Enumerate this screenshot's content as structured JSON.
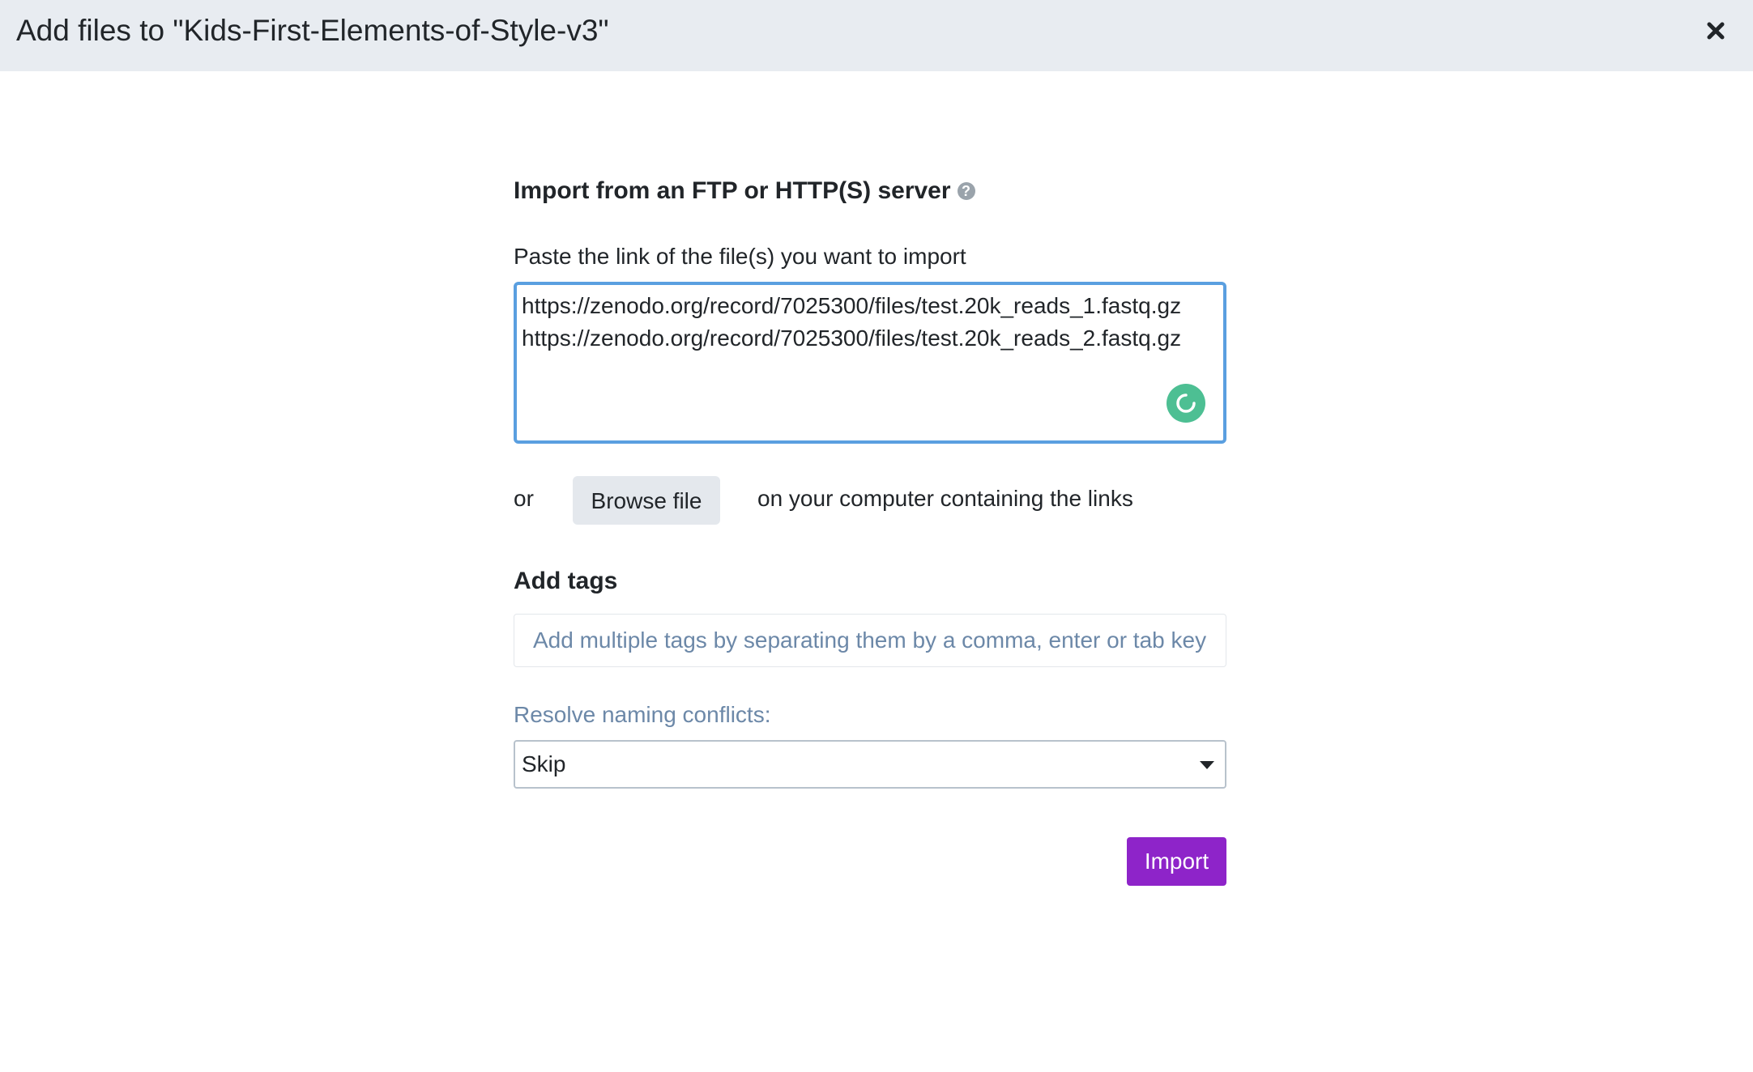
{
  "modal": {
    "title": "Add files to \"Kids-First-Elements-of-Style-v3\"",
    "close_icon": "close-icon"
  },
  "import_section": {
    "title": "Import from an FTP or HTTP(S) server",
    "help_icon": "question-circle-icon",
    "help_glyph": "?",
    "paste_label": "Paste the link of the file(s) you want to import",
    "urls_value": "https://zenodo.org/record/7025300/files/test.20k_reads_1.fastq.gz\nhttps://zenodo.org/record/7025300/files/test.20k_reads_2.fastq.gz",
    "spinner_icon": "loading-spinner-icon"
  },
  "browse": {
    "or_text": "or",
    "button_label": "Browse file",
    "after_text": "on your computer containing the links"
  },
  "tags": {
    "title": "Add tags",
    "placeholder": "Add multiple tags by separating them by a comma, enter or tab key"
  },
  "conflicts": {
    "label": "Resolve naming conflicts:",
    "selected": "Skip",
    "caret_icon": "caret-down-icon"
  },
  "actions": {
    "import_label": "Import"
  },
  "colors": {
    "header_bg": "#e8ecf1",
    "focus_border": "#5a9fe0",
    "spinner": "#4dbf93",
    "import_button": "#8e24c9",
    "muted_text": "#6c88a8"
  }
}
